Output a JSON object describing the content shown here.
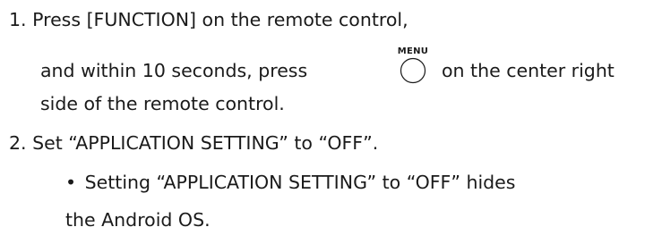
{
  "steps": [
    {
      "number": "1.",
      "line1": "Press [FUNCTION] on the remote control,",
      "line2_before": "and within 10 seconds, press",
      "key_label": "MENU",
      "key_icon": "round-button-icon",
      "line2_after": "on the center right",
      "line3": "side of the remote control."
    },
    {
      "number": "2.",
      "line1": "Set “APPLICATION SETTING” to “OFF”.",
      "bullet": {
        "glyph": "•",
        "line1": "Setting “APPLICATION SETTING” to “OFF” hides",
        "line2": "the Android OS."
      }
    }
  ]
}
